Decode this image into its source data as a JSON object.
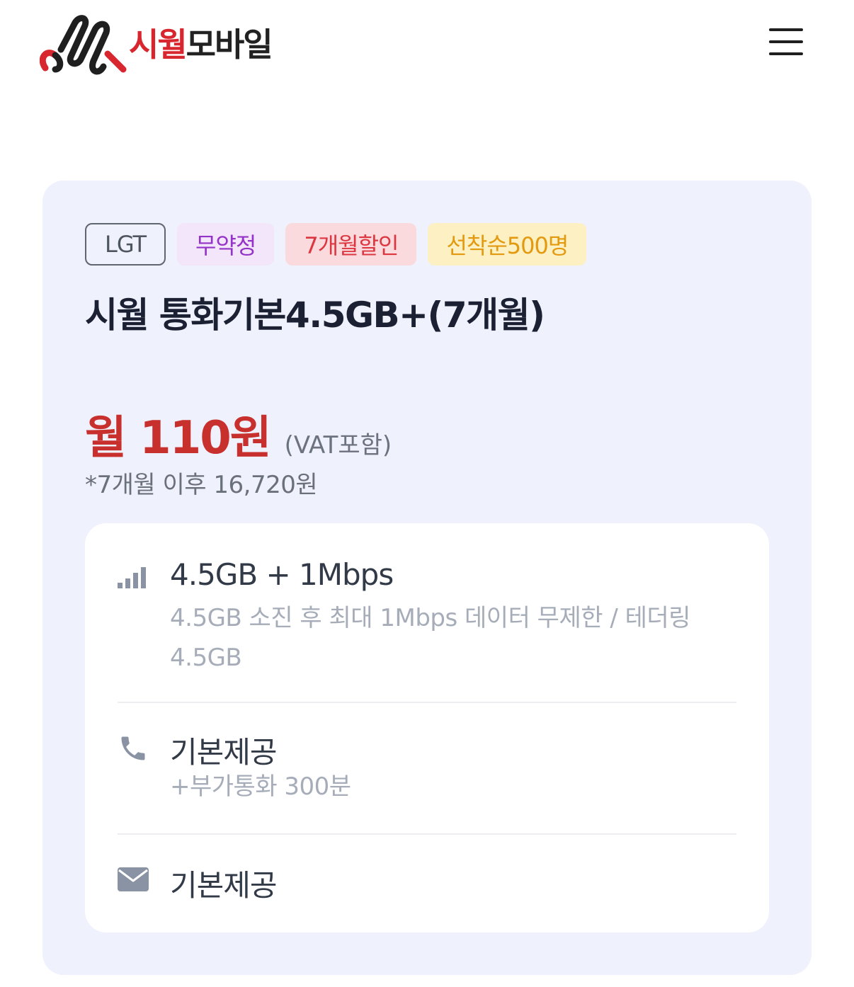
{
  "header": {
    "brand_red": "시월",
    "brand_dark": "모바일",
    "menu_icon": "hamburger-menu-icon"
  },
  "plan": {
    "tags": [
      {
        "label": "LGT",
        "style": "carrier"
      },
      {
        "label": "무약정",
        "style": "purple"
      },
      {
        "label": "7개월할인",
        "style": "red"
      },
      {
        "label": "선착순500명",
        "style": "yellow"
      }
    ],
    "title": "시월 통화기본4.5GB+(7개월)",
    "price": "월 110원",
    "vat_note": "(VAT포함)",
    "after_price_note": "*7개월 이후 16,720원"
  },
  "features": {
    "data": {
      "icon": "signal-bars-icon",
      "title": "4.5GB + 1Mbps",
      "desc": "4.5GB 소진 후 최대 1Mbps 데이터 무제한 / 테더링 4.5GB"
    },
    "call": {
      "icon": "phone-icon",
      "title": "기본제공",
      "desc": "+부가통화 300분"
    },
    "sms": {
      "icon": "envelope-icon",
      "title": "기본제공"
    }
  },
  "colors": {
    "accent_red": "#c8302e",
    "card_bg": "#eff1fc",
    "tag_purple": "#9433c7",
    "tag_red": "#dc3640",
    "tag_yellow": "#e39a11"
  }
}
